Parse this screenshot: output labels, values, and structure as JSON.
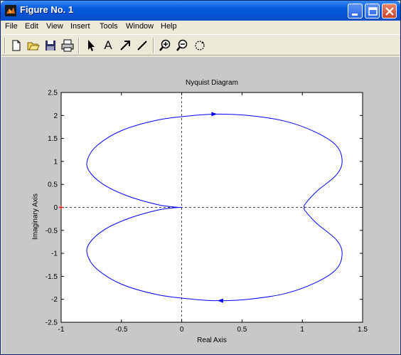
{
  "window": {
    "title": "Figure No. 1"
  },
  "menu": [
    "File",
    "Edit",
    "View",
    "Insert",
    "Tools",
    "Window",
    "Help"
  ],
  "toolbar": {
    "icons": [
      "new-file-icon",
      "open-folder-icon",
      "save-icon",
      "print-icon",
      "pointer-icon",
      "text-icon",
      "arrow-icon",
      "line-icon",
      "zoom-in-icon",
      "zoom-out-icon",
      "rotate-icon"
    ],
    "text_tool_label": "A"
  },
  "chart_data": {
    "type": "line",
    "title": "Nyquist Diagram",
    "xlabel": "Real Axis",
    "ylabel": "Imaginary Axis",
    "xlim": [
      -1,
      1.5
    ],
    "ylim": [
      -2.5,
      2.5
    ],
    "xticks": [
      "-1",
      "-0.5",
      "0",
      "0.5",
      "1",
      "1.5"
    ],
    "yticks": [
      "2.5",
      "2",
      "1.5",
      "1",
      "0.5",
      "0",
      "-0.5",
      "-1",
      "-1.5",
      "-2",
      "-2.5"
    ],
    "line_color": "#0000ff",
    "critical_point_color": "#ff0000",
    "critical_point": [
      -1,
      0
    ],
    "series": [
      {
        "values": [
          [
            0,
            0
          ],
          [
            -0.05,
            0.005
          ],
          [
            -0.2,
            0.06
          ],
          [
            -0.45,
            0.25
          ],
          [
            -0.65,
            0.5
          ],
          [
            -0.77,
            0.8
          ],
          [
            -0.78,
            1.05
          ],
          [
            -0.7,
            1.35
          ],
          [
            -0.5,
            1.67
          ],
          [
            -0.2,
            1.9
          ],
          [
            0.1,
            2.0
          ],
          [
            0.3,
            2.03
          ],
          [
            0.55,
            2.0
          ],
          [
            0.85,
            1.88
          ],
          [
            1.1,
            1.65
          ],
          [
            1.28,
            1.35
          ],
          [
            1.33,
            1.0
          ],
          [
            1.28,
            0.7
          ],
          [
            1.12,
            0.35
          ],
          [
            1.02,
            0.06
          ],
          [
            1.02,
            0
          ],
          [
            1.02,
            -0.06
          ],
          [
            1.12,
            -0.35
          ],
          [
            1.28,
            -0.7
          ],
          [
            1.33,
            -1.0
          ],
          [
            1.28,
            -1.35
          ],
          [
            1.1,
            -1.65
          ],
          [
            0.85,
            -1.88
          ],
          [
            0.55,
            -2.0
          ],
          [
            0.3,
            -2.03
          ],
          [
            0.1,
            -2.0
          ],
          [
            -0.2,
            -1.9
          ],
          [
            -0.5,
            -1.67
          ],
          [
            -0.7,
            -1.35
          ],
          [
            -0.78,
            -1.05
          ],
          [
            -0.77,
            -0.8
          ],
          [
            -0.65,
            -0.5
          ],
          [
            -0.45,
            -0.25
          ],
          [
            -0.2,
            -0.06
          ],
          [
            -0.05,
            -0.005
          ],
          [
            0,
            0
          ]
        ],
        "arrows": [
          {
            "at": [
              0.27,
              2.03
            ],
            "direction": "right"
          },
          {
            "at": [
              0.32,
              -2.03
            ],
            "direction": "left"
          }
        ]
      }
    ]
  }
}
